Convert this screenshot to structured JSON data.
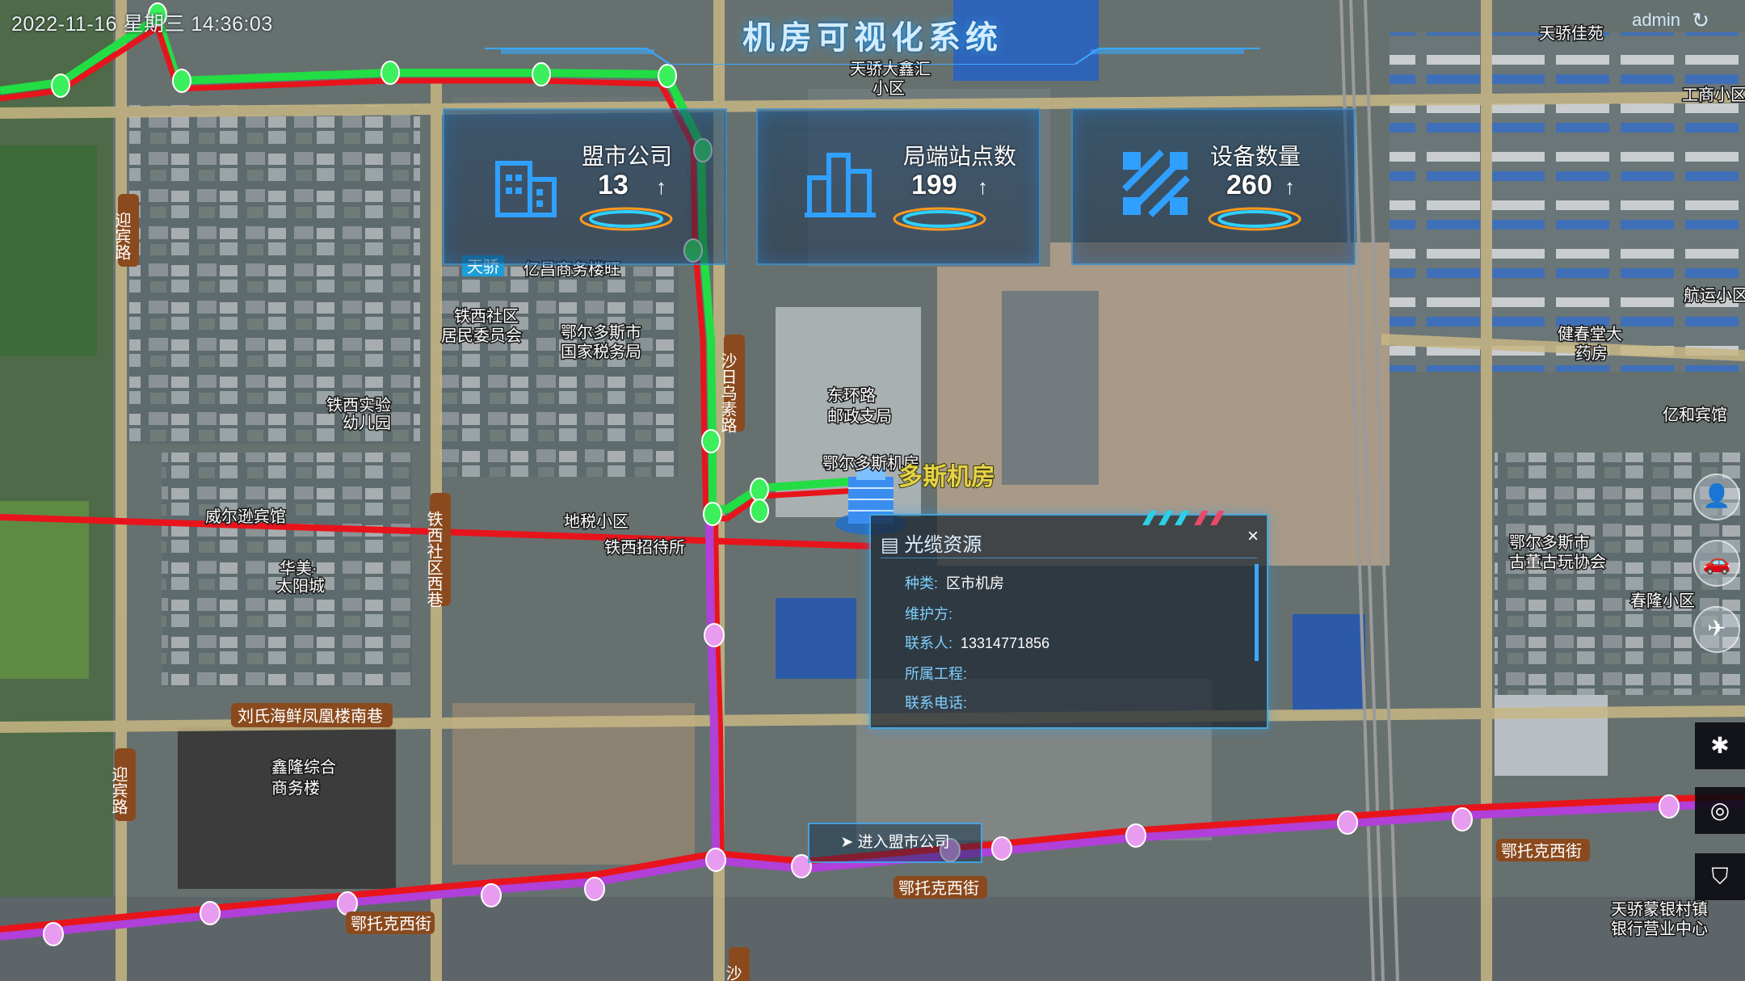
{
  "header": {
    "datetime": "2022-11-16 星期三 14:36:03",
    "title": "机房可视化系统",
    "username": "admin"
  },
  "stats": [
    {
      "label": "盟市公司",
      "value": "13",
      "trend": "↑",
      "icon": "building-icon"
    },
    {
      "label": "局端站点数",
      "value": "199",
      "trend": "↑",
      "icon": "buildings-icon"
    },
    {
      "label": "设备数量",
      "value": "260",
      "trend": "↑",
      "icon": "network-icon"
    }
  ],
  "popup": {
    "title": "光缆资源",
    "close": "×",
    "rows": [
      {
        "key": "种类:",
        "value": "区市机房"
      },
      {
        "key": "维护方:",
        "value": ""
      },
      {
        "key": "联系人:",
        "value": "13314771856"
      },
      {
        "key": "所属工程:",
        "value": ""
      },
      {
        "key": "联系电话:",
        "value": ""
      }
    ]
  },
  "enter_button": {
    "label": "进入盟市公司"
  },
  "marker": {
    "name": "鄂尔多斯机房",
    "label": "多斯机房"
  },
  "map_labels": {
    "l1": "天骄佳苑",
    "l2": "天骄大鑫汇",
    "l3": "小区",
    "l4": "工商小区",
    "l5": "天骄",
    "l6": "亿昌商务楼旺",
    "l7": "铁西社区",
    "l8": "居民委员会",
    "l9": "鄂尔多斯市",
    "l10": "国家税务局",
    "l11": "铁西实验",
    "l12": "幼儿园",
    "l13": "东环路",
    "l14": "邮政支局",
    "l15": "地税小区",
    "l16": "威尔逊宾馆",
    "l17": "华美·",
    "l18": "太阳城",
    "l19": "健春堂大",
    "l20": "药房",
    "l21": "亿和宾馆",
    "l22": "鄂尔多斯市",
    "l23": "古董古玩协会",
    "l24": "春隆小区",
    "l25": "航运小区",
    "l26": "刘氏海鲜凤凰楼南巷",
    "l27": "鑫隆综合",
    "l28": "商务楼",
    "l29": "天骄蒙银村镇",
    "l30": "银行营业中心",
    "l31": "铁西招待所",
    "r1": "迎宾路",
    "r2": "沙日乌素路",
    "r3": "铁西社区西巷",
    "r4": "鄂托克西街",
    "r5": "鄂托克西街",
    "r6": "鄂托克西街",
    "r7": "迎宾路",
    "r8": "沙日"
  },
  "right_toolbar": {
    "round": [
      "user-icon",
      "car-icon",
      "plane-icon"
    ],
    "square": [
      "puzzle-icon",
      "camera-icon",
      "shield-icon"
    ]
  },
  "colors": {
    "route_red": "#e8141c",
    "route_green": "#22dd44",
    "route_purple": "#b040d8",
    "accent": "#3aa8ff"
  }
}
